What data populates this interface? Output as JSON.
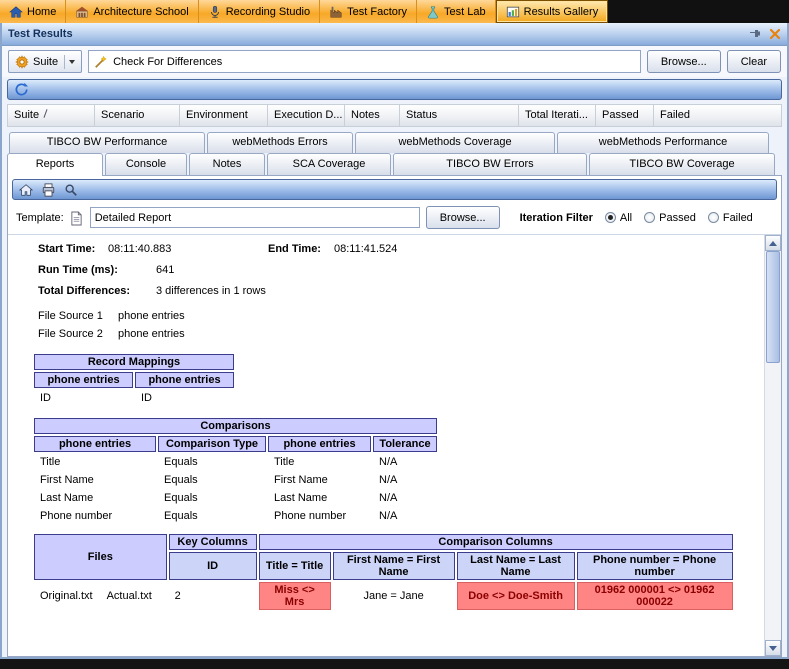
{
  "topnav": {
    "items": [
      {
        "label": "Home"
      },
      {
        "label": "Architecture School"
      },
      {
        "label": "Recording Studio"
      },
      {
        "label": "Test Factory"
      },
      {
        "label": "Test Lab"
      },
      {
        "label": "Results Gallery"
      }
    ],
    "selected": "Results Gallery"
  },
  "titlebar": {
    "title": "Test Results"
  },
  "suite_toolbar": {
    "suite_button": "Suite",
    "filter_value": "Check For Differences",
    "browse_button": "Browse...",
    "clear_button": "Clear"
  },
  "results_grid": {
    "columns": [
      "Suite",
      "Scenario",
      "Environment",
      "Execution D...",
      "Notes",
      "Status",
      "Total Iterati...",
      "Passed",
      "Failed"
    ]
  },
  "tabs": {
    "back_row": [
      "TIBCO BW Performance",
      "webMethods Errors",
      "webMethods Coverage",
      "webMethods Performance"
    ],
    "front_row": [
      "Reports",
      "Console",
      "Notes",
      "SCA Coverage",
      "TIBCO BW Errors",
      "TIBCO BW Coverage"
    ],
    "selected": "Reports"
  },
  "report_bar": {
    "template_label": "Template:",
    "template_value": "Detailed Report",
    "browse_button": "Browse...",
    "iteration_filter_label": "Iteration Filter",
    "radios": [
      "All",
      "Passed",
      "Failed"
    ],
    "selected_radio": "All"
  },
  "report": {
    "start_time_label": "Start Time:",
    "start_time": "08:11:40.883",
    "end_time_label": "End Time:",
    "end_time": "08:11:41.524",
    "run_time_label": "Run Time (ms):",
    "run_time": "641",
    "total_diff_label": "Total Differences:",
    "total_diff": "3 differences in 1 rows",
    "file_source_1_label": "File Source 1",
    "file_source_1": "phone entries",
    "file_source_2_label": "File Source 2",
    "file_source_2": "phone entries",
    "record_mappings": {
      "title": "Record Mappings",
      "headers": [
        "phone entries",
        "phone entries"
      ],
      "row": [
        "ID",
        "ID"
      ]
    },
    "comparisons": {
      "title": "Comparisons",
      "headers": [
        "phone entries",
        "Comparison Type",
        "phone entries",
        "Tolerance"
      ],
      "rows": [
        [
          "Title",
          "Equals",
          "Title",
          "N/A"
        ],
        [
          "First Name",
          "Equals",
          "First Name",
          "N/A"
        ],
        [
          "Last Name",
          "Equals",
          "Last Name",
          "N/A"
        ],
        [
          "Phone number",
          "Equals",
          "Phone number",
          "N/A"
        ]
      ]
    },
    "files": {
      "files_header": "Files",
      "key_columns_header": "Key Columns",
      "key_sub_header": "ID",
      "comparison_columns_header": "Comparison Columns",
      "sub_headers": [
        "Title = Title",
        "First Name = First Name",
        "Last Name = Last Name",
        "Phone number = Phone number"
      ],
      "row": {
        "file_1": "Original.txt",
        "file_2": "Actual.txt",
        "key_value": "2",
        "values": [
          {
            "text": "Miss <> Mrs",
            "diff": true
          },
          {
            "text": "Jane = Jane",
            "diff": false
          },
          {
            "text": "Doe <> Doe-Smith",
            "diff": true
          },
          {
            "text": "01962 000001 <> 01962 000022",
            "diff": true
          }
        ]
      }
    }
  },
  "colors": {
    "header_lavender": "#ccccff",
    "diff_red_bg": "#ff8585",
    "diff_red_text": "#8b0000",
    "nav_orange": "#f7a826",
    "toolbar_blue": "#6e97d2"
  }
}
